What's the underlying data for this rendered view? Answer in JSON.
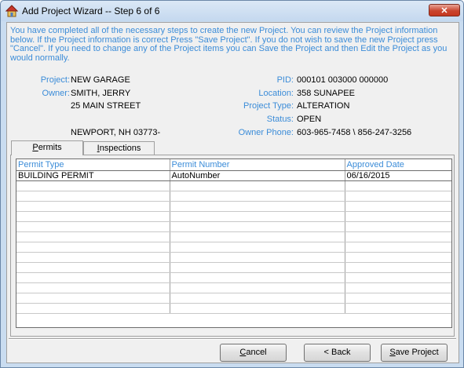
{
  "window": {
    "title": "Add Project Wizard -- Step 6 of 6",
    "close_label": "✕",
    "icon": "house-icon"
  },
  "intro": {
    "text": "You have completed all of the necessary steps to create the new Project.  You can review the Project information below.  If the Project information is correct Press \"Save Project\".  If you do not wish to save the new Project press \"Cancel\".  If you need to change any of the Project items you can Save the Project and then Edit the Project as you would normally."
  },
  "project": {
    "project_label": "Project:",
    "project_value": "NEW GARAGE",
    "owner_label": "Owner:",
    "owner_name": "SMITH, JERRY",
    "owner_address1": "25 MAIN STREET",
    "owner_city": "NEWPORT, NH  03773-",
    "pid_label": "PID:",
    "pid_value": "000101 003000 000000",
    "location_label": "Location:",
    "location_value": "358 SUNAPEE",
    "type_label": "Project Type:",
    "type_value": "ALTERATION",
    "status_label": "Status:",
    "status_value": "OPEN",
    "phone_label": "Owner Phone:",
    "phone_value": "603-965-7458 \\ 856-247-3256"
  },
  "tabs": {
    "permits_first": "P",
    "permits_rest": "ermits",
    "inspections_first": "I",
    "inspections_rest": "nspections"
  },
  "grid": {
    "columns": [
      "Permit Type",
      "Permit Number",
      "Approved Date"
    ],
    "rows": [
      [
        "BUILDING PERMIT",
        "AutoNumber",
        "06/16/2015"
      ]
    ]
  },
  "buttons": {
    "cancel_first": "C",
    "cancel_rest": "ancel",
    "back_label": "< Back",
    "save_first": "S",
    "save_rest": "ave Project"
  },
  "colors": {
    "accent_text": "#3b8cd8",
    "close_button": "#c6371f"
  }
}
